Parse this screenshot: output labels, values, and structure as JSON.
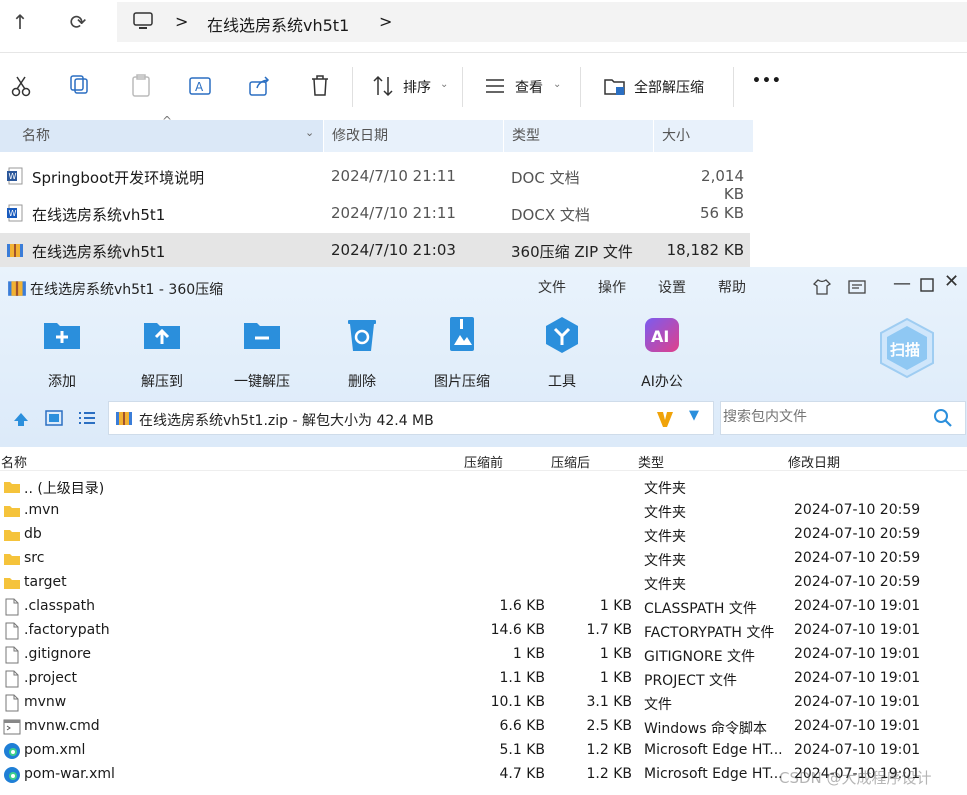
{
  "explorer": {
    "nav": {
      "up_icon": "↑",
      "refresh_icon": "⟳"
    },
    "breadcrumb": {
      "sep1": ">",
      "folder": "在线选房系统vh5t1",
      "sep2": ">"
    },
    "toolbar": {
      "sort_label": "排序",
      "view_label": "查看",
      "extract_all_label": "全部解压缩",
      "more_label": "•••"
    },
    "columns": {
      "name": "名称",
      "modified": "修改日期",
      "type": "类型",
      "size": "大小"
    },
    "files": [
      {
        "name": "Springboot开发环境说明",
        "modified": "2024/7/10 21:11",
        "type": "DOC 文档",
        "size": "2,014 KB",
        "icon": "word-doc-icon"
      },
      {
        "name": "在线选房系统vh5t1",
        "modified": "2024/7/10 21:11",
        "type": "DOCX 文档",
        "size": "56 KB",
        "icon": "word-docx-icon"
      },
      {
        "name": "在线选房系统vh5t1",
        "modified": "2024/7/10 21:03",
        "type": "360压缩 ZIP 文件",
        "size": "18,182 KB",
        "icon": "zip-archive-icon"
      }
    ]
  },
  "zip": {
    "title": "在线选房系统vh5t1 - 360压缩",
    "menu": [
      "文件",
      "操作",
      "设置",
      "帮助"
    ],
    "buttons": [
      "添加",
      "解压到",
      "一键解压",
      "删除",
      "图片压缩",
      "工具",
      "AI办公"
    ],
    "scan_label": "扫描",
    "path": "在线选房系统vh5t1.zip - 解包大小为 42.4 MB",
    "search_placeholder": "搜索包内文件",
    "columns": {
      "name": "名称",
      "before": "压缩前",
      "after": "压缩后",
      "type": "类型",
      "modified": "修改日期"
    },
    "rows": [
      {
        "name": ".. (上级目录)",
        "before": "",
        "after": "",
        "type": "文件夹",
        "modified": "",
        "icon": "folder"
      },
      {
        "name": ".mvn",
        "before": "",
        "after": "",
        "type": "文件夹",
        "modified": "2024-07-10 20:59",
        "icon": "folder"
      },
      {
        "name": "db",
        "before": "",
        "after": "",
        "type": "文件夹",
        "modified": "2024-07-10 20:59",
        "icon": "folder"
      },
      {
        "name": "src",
        "before": "",
        "after": "",
        "type": "文件夹",
        "modified": "2024-07-10 20:59",
        "icon": "folder"
      },
      {
        "name": "target",
        "before": "",
        "after": "",
        "type": "文件夹",
        "modified": "2024-07-10 20:59",
        "icon": "folder"
      },
      {
        "name": ".classpath",
        "before": "1.6 KB",
        "after": "1 KB",
        "type": "CLASSPATH 文件",
        "modified": "2024-07-10 19:01",
        "icon": "file"
      },
      {
        "name": ".factorypath",
        "before": "14.6 KB",
        "after": "1.7 KB",
        "type": "FACTORYPATH 文件",
        "modified": "2024-07-10 19:01",
        "icon": "file"
      },
      {
        "name": ".gitignore",
        "before": "1 KB",
        "after": "1 KB",
        "type": "GITIGNORE 文件",
        "modified": "2024-07-10 19:01",
        "icon": "file"
      },
      {
        "name": ".project",
        "before": "1.1 KB",
        "after": "1 KB",
        "type": "PROJECT 文件",
        "modified": "2024-07-10 19:01",
        "icon": "file"
      },
      {
        "name": "mvnw",
        "before": "10.1 KB",
        "after": "3.1 KB",
        "type": "文件",
        "modified": "2024-07-10 19:01",
        "icon": "file"
      },
      {
        "name": "mvnw.cmd",
        "before": "6.6 KB",
        "after": "2.5 KB",
        "type": "Windows 命令脚本",
        "modified": "2024-07-10 19:01",
        "icon": "cmd"
      },
      {
        "name": "pom.xml",
        "before": "5.1 KB",
        "after": "1.2 KB",
        "type": "Microsoft Edge HT...",
        "modified": "2024-07-10 19:01",
        "icon": "edge"
      },
      {
        "name": "pom-war.xml",
        "before": "4.7 KB",
        "after": "1.2 KB",
        "type": "Microsoft Edge HT...",
        "modified": "2024-07-10 19:01",
        "icon": "edge"
      }
    ],
    "watermark": "CSDN @大成程序设计"
  },
  "colors": {
    "folder": "#f5c33b",
    "accent": "#2b8fdc",
    "selection": "#e5e5e5",
    "header_blue": "#dbe8f7"
  }
}
